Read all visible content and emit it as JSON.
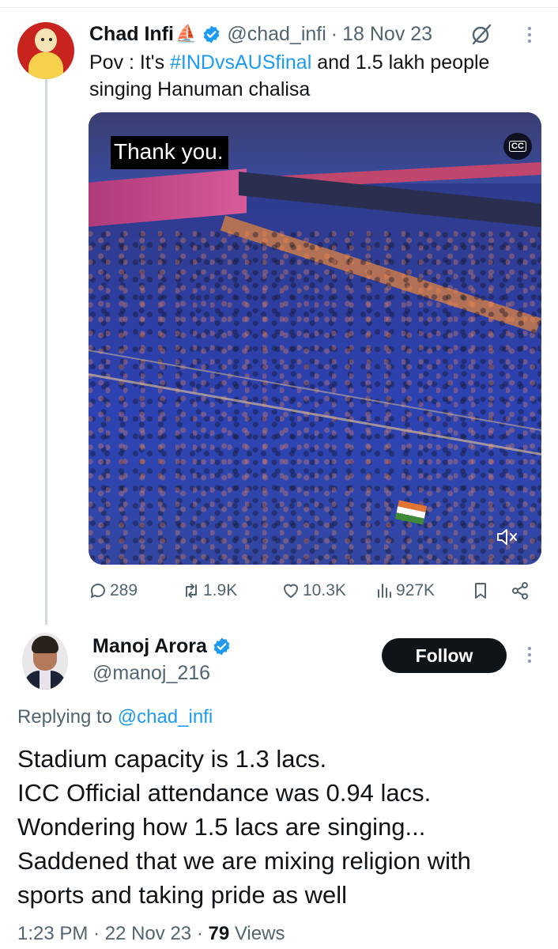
{
  "parent_tweet": {
    "author_name": "Chad Infi",
    "name_emoji": "⛵",
    "handle": "@chad_infi",
    "separator": "·",
    "date": "18 Nov 23",
    "text_before": "Pov : It's ",
    "hashtag": "#INDvsAUSfinal",
    "text_after": " and 1.5 lakh people singing Hanuman chalisa",
    "media": {
      "caption": "Thank you.",
      "cc_label": "CC"
    },
    "stats": {
      "replies": "289",
      "reposts": "1.9K",
      "likes": "10.3K",
      "views": "927K"
    }
  },
  "reply_tweet": {
    "author_name": "Manoj Arora",
    "handle": "@manoj_216",
    "follow_label": "Follow",
    "replying_prefix": "Replying to ",
    "replying_to": "@chad_infi",
    "text_lines": [
      "Stadium capacity is 1.3 lacs.",
      "ICC Official attendance was 0.94 lacs.",
      "Wondering how 1.5 lacs are singing...",
      "Saddened that we are mixing religion with",
      "sports and taking pride as well"
    ],
    "time": "1:23 PM",
    "separator": "·",
    "date": "22 Nov 23",
    "views_count": "79",
    "views_label": "Views"
  },
  "colors": {
    "accent": "#1d9bf0",
    "text_primary": "#0f1419",
    "text_secondary": "#536471",
    "follow_bg": "#0f1419"
  },
  "icons": [
    "verified-badge-icon",
    "grok-icon",
    "more-icon",
    "cc-icon",
    "mute-icon",
    "reply-icon",
    "repost-icon",
    "like-icon",
    "views-icon",
    "bookmark-icon",
    "share-icon"
  ]
}
